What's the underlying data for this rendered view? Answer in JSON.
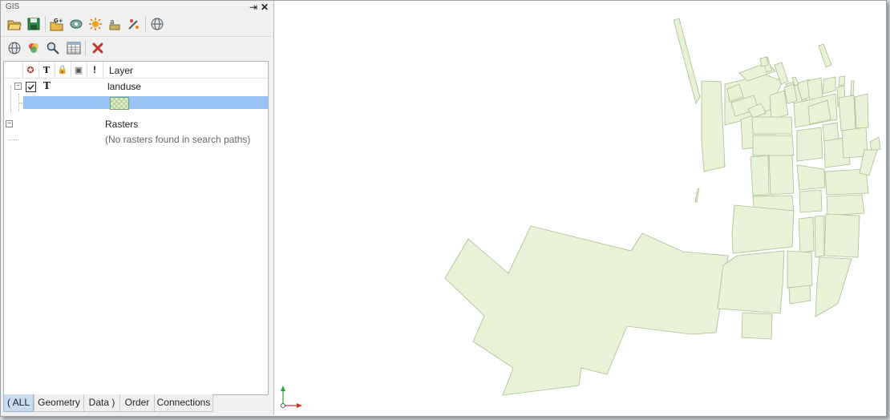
{
  "panel": {
    "title": "GIS"
  },
  "header_buttons": {
    "pin": "⇥",
    "close": "✕"
  },
  "toolbar1": {
    "items": [
      "open-icon",
      "save-icon",
      "add-layer-icon",
      "link-icon",
      "sun-icon",
      "label-icon",
      "wand-icon",
      "globe-icon"
    ]
  },
  "toolbar2": {
    "items": [
      "globe-icon",
      "color-layers-icon",
      "search-icon",
      "table-icon",
      "delete-icon"
    ]
  },
  "tree": {
    "columns": {
      "visible": "✪",
      "text": "T",
      "lock": "🔒",
      "snap": "▣",
      "warn": "!",
      "layer": "Layer"
    },
    "layer_group": {
      "name": "landuse",
      "text_marker": "T"
    },
    "rasters": {
      "name": "Rasters",
      "empty_message": "(No rasters found in search paths)"
    }
  },
  "tabs": [
    "( ALL",
    "Geometry",
    "Data )",
    "Order",
    "Connections"
  ],
  "map": {
    "fill_color": "#e8f2d6",
    "stroke_color": "#a8bf8e",
    "axis_y_color": "#2ea043",
    "axis_x_color": "#d0302b"
  }
}
